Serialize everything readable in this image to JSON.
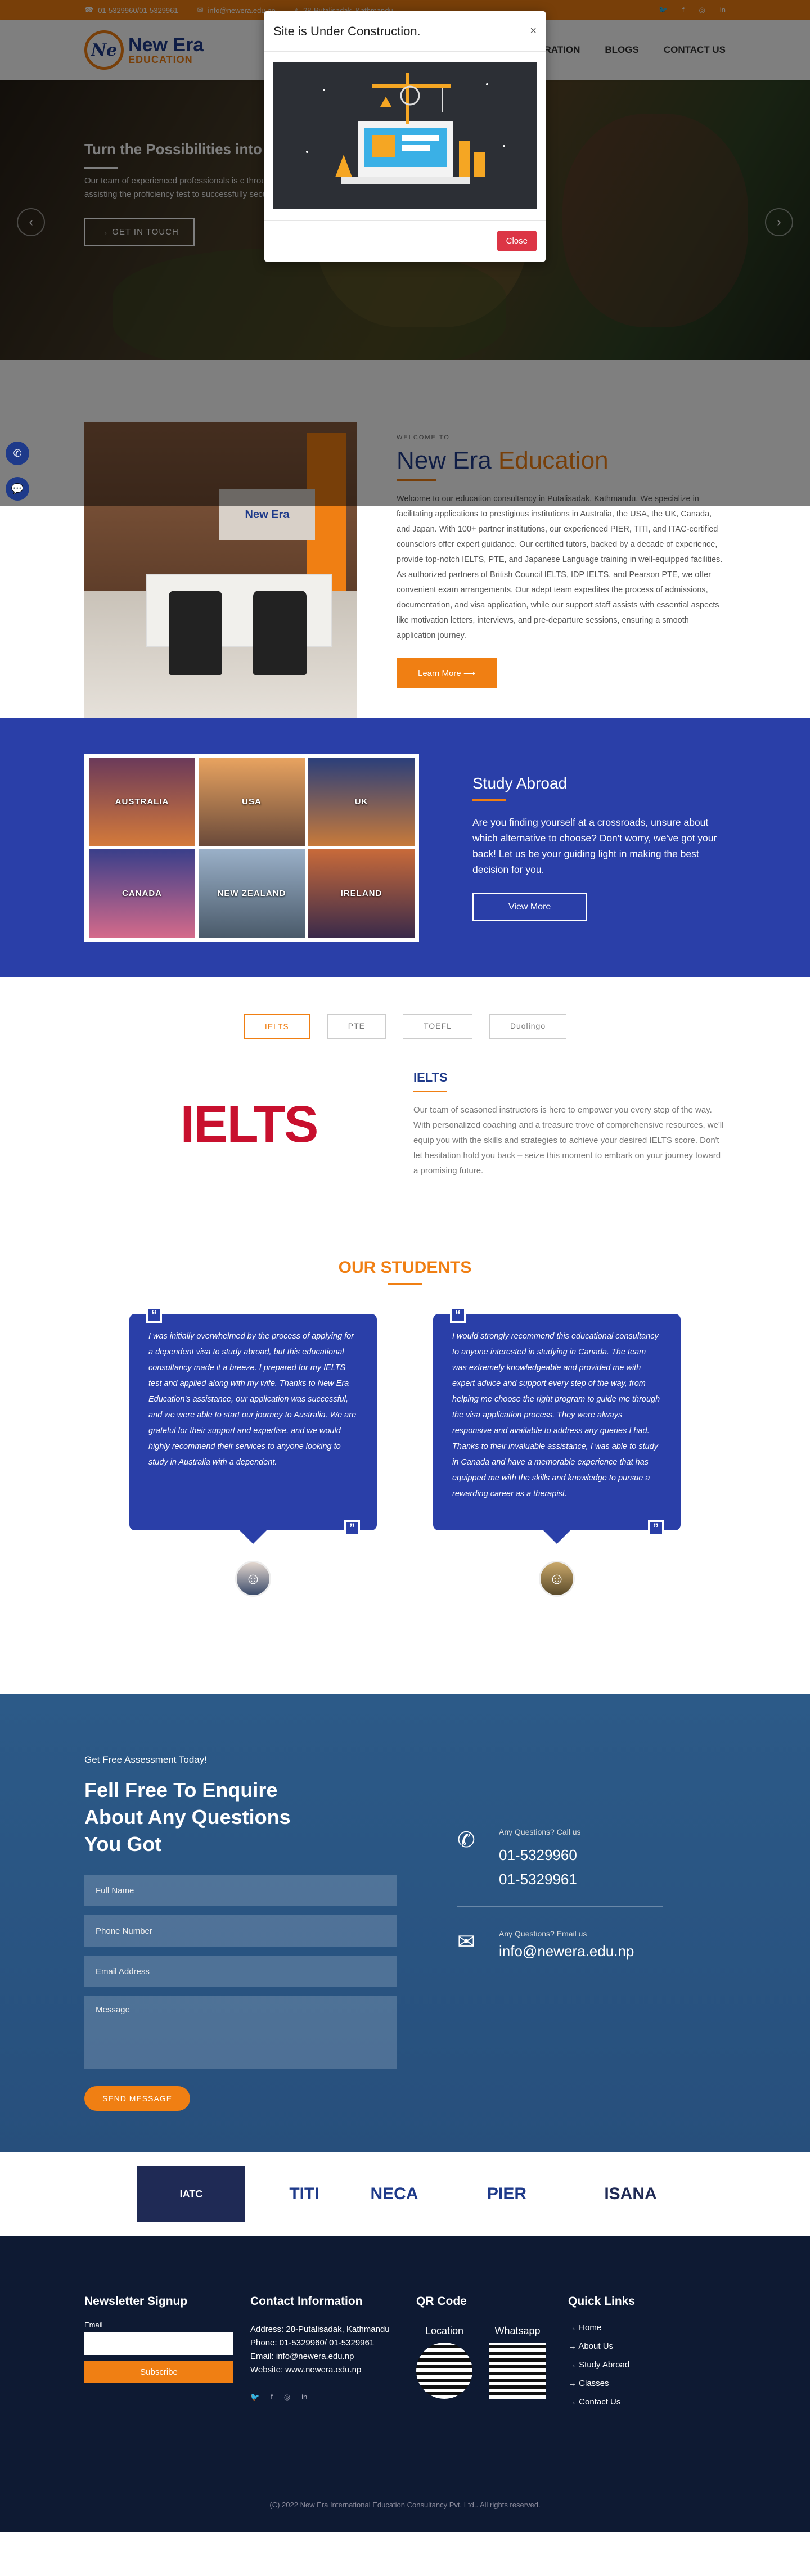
{
  "topbar": {
    "phone": "01-5329960/01-5329961",
    "email": "info@newera.edu.np",
    "address": "28-Putalisadak, Kathmandu"
  },
  "nav": {
    "logo_mark": "Ne",
    "logo_line1": "New Era",
    "logo_line2": "EDUCATION",
    "menu": [
      "TEST PREPARATION",
      "BLOGS",
      "CONTACT US"
    ]
  },
  "hero": {
    "title": "Turn the Possibilities into Rea",
    "text": "Our team of experienced professionals is c throughout the entire journey, assisting the proficiency test to successfully secure their",
    "button": "→ GET IN TOUCH"
  },
  "modal": {
    "title": "Site is Under Construction.",
    "close_label": "Close"
  },
  "welcome": {
    "eyebrow": "WELCOME TO",
    "title_blue": "New Era",
    "title_orange": "Education",
    "office_sign": "New Era",
    "body": "Welcome to our education consultancy in Putalisadak, Kathmandu. We specialize in facilitating applications to prestigious institutions in Australia, the USA, the UK, Canada, and Japan. With 100+ partner institutions, our experienced PIER, TITI, and ITAC-certified counselors offer expert guidance. Our certified tutors, backed by a decade of experience, provide top-notch IELTS, PTE, and Japanese Language training in well-equipped facilities. As authorized partners of British Council IELTS, IDP IELTS, and Pearson PTE, we offer convenient exam arrangements. Our adept team expedites the process of admissions, documentation, and visa application, while our support staff assists with essential aspects like motivation letters, interviews, and pre-departure sessions, ensuring a smooth application journey.",
    "button": "Learn More"
  },
  "study": {
    "countries": [
      "AUSTRALIA",
      "USA",
      "UK",
      "CANADA",
      "NEW ZEALAND",
      "IRELAND"
    ],
    "title": "Study Abroad",
    "body": "Are you finding yourself at a crossroads, unsure about which alternative to choose? Don't worry, we've got your back! Let us be your guiding light in making the best decision for you.",
    "button": "View More"
  },
  "tabs": {
    "items": [
      "IELTS",
      "PTE",
      "TOEFL",
      "Duolingo"
    ],
    "logo": "IELTS",
    "title": "IELTS",
    "body": "Our team of seasoned instructors is here to empower you every step of the way. With personalized coaching and a treasure trove of comprehensive resources, we'll equip you with the skills and strategies to achieve your desired IELTS score. Don't let hesitation hold you back – seize this moment to embark on your journey toward a promising future."
  },
  "students": {
    "title": "OUR STUDENTS",
    "testimonials": [
      {
        "text": "I was initially overwhelmed by the process of applying for a dependent visa to study abroad, but this educational consultancy made it a breeze. I prepared for my IELTS test and applied along with my wife. Thanks to New Era Education's assistance, our application was successful, and we were able to start our journey to Australia. We are grateful for their support and expertise, and we would highly recommend their services to anyone looking to study in Australia with a dependent."
      },
      {
        "text": "I would strongly recommend this educational consultancy to anyone interested in studying in Canada. The team was extremely knowledgeable and provided me with expert advice and support every step of the way, from helping me choose the right program to guide me through the visa application process. They were always responsive and available to address any queries I had. Thanks to their invaluable assistance, I was able to study in Canada and have a memorable experience that has equipped me with the skills and knowledge to pursue a rewarding career as a therapist."
      }
    ]
  },
  "enquiry": {
    "eyebrow": "Get Free Assessment Today!",
    "title": "Fell Free To Enquire About Any Questions You Got",
    "fields": {
      "name": "Full Name",
      "phone": "Phone Number",
      "email": "Email Address",
      "message": "Message"
    },
    "button": "SEND MESSAGE",
    "call_label": "Any Questions? Call us",
    "phone1": "01-5329960",
    "phone2": "01-5329961",
    "email_label": "Any Questions? Email us",
    "email": "info@newera.edu.np"
  },
  "partners": [
    "IATC",
    "TITI",
    "NECA",
    "PIER",
    "ISANA"
  ],
  "footer": {
    "newsletter_title": "Newsletter Signup",
    "email_label": "Email",
    "subscribe": "Subscribe",
    "contact_title": "Contact Information",
    "address": "Address: 28-Putalisadak, Kathmandu",
    "phone": "Phone: 01-5329960/ 01-5329961",
    "email": "Email: info@newera.edu.np",
    "website": "Website: www.newera.edu.np",
    "qr_title": "QR Code",
    "qr_location": "Location",
    "qr_whatsapp": "Whatsapp",
    "links_title": "Quick Links",
    "links": [
      "Home",
      "About Us",
      "Study Abroad",
      "Classes",
      "Contact Us"
    ],
    "copyright": "(C) 2022 New Era International Education Consultancy Pvt. Ltd.. All rights reserved."
  },
  "colors": {
    "brand_orange": "#f07f13",
    "brand_blue": "#1e3a8a",
    "study_bg": "#2a3fa8",
    "footer_bg": "#0e1a33"
  }
}
